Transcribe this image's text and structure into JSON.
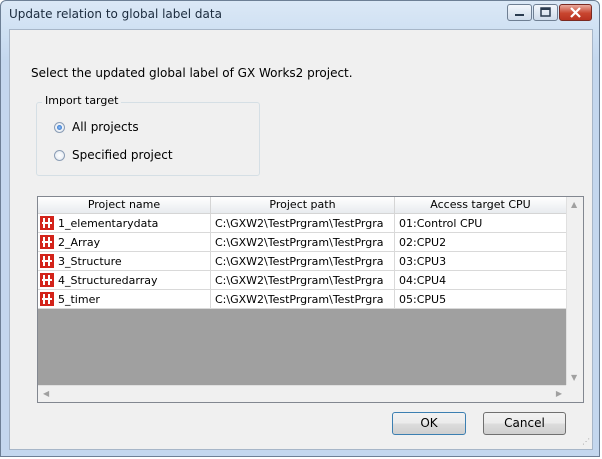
{
  "window": {
    "title": "Update relation to global label data"
  },
  "dialog": {
    "prompt": "Select the updated global label of GX Works2 project.",
    "import_target": {
      "legend": "Import target",
      "options": [
        {
          "label": "All projects",
          "selected": true
        },
        {
          "label": "Specified project",
          "selected": false
        }
      ]
    }
  },
  "table": {
    "columns": [
      "Project name",
      "Project path",
      "Access target CPU"
    ],
    "rows": [
      {
        "name": "1_elementarydata",
        "path": "C:\\GXW2\\TestPrgram\\TestPrgra",
        "cpu": "01:Control CPU"
      },
      {
        "name": "2_Array",
        "path": "C:\\GXW2\\TestPrgram\\TestPrgra",
        "cpu": "02:CPU2"
      },
      {
        "name": "3_Structure",
        "path": "C:\\GXW2\\TestPrgram\\TestPrgra",
        "cpu": "03:CPU3"
      },
      {
        "name": "4_Structuredarray",
        "path": "C:\\GXW2\\TestPrgram\\TestPrgra",
        "cpu": "04:CPU4"
      },
      {
        "name": "5_timer",
        "path": "C:\\GXW2\\TestPrgram\\TestPrgra",
        "cpu": "05:CPU5"
      }
    ]
  },
  "buttons": {
    "ok": "OK",
    "cancel": "Cancel"
  },
  "icons": {
    "row_icon": "project-icon",
    "title_buttons": [
      "minimize-icon",
      "maximize-icon",
      "close-icon"
    ]
  },
  "colors": {
    "project_icon": "#d3231a",
    "close_button": "#c8452f"
  }
}
